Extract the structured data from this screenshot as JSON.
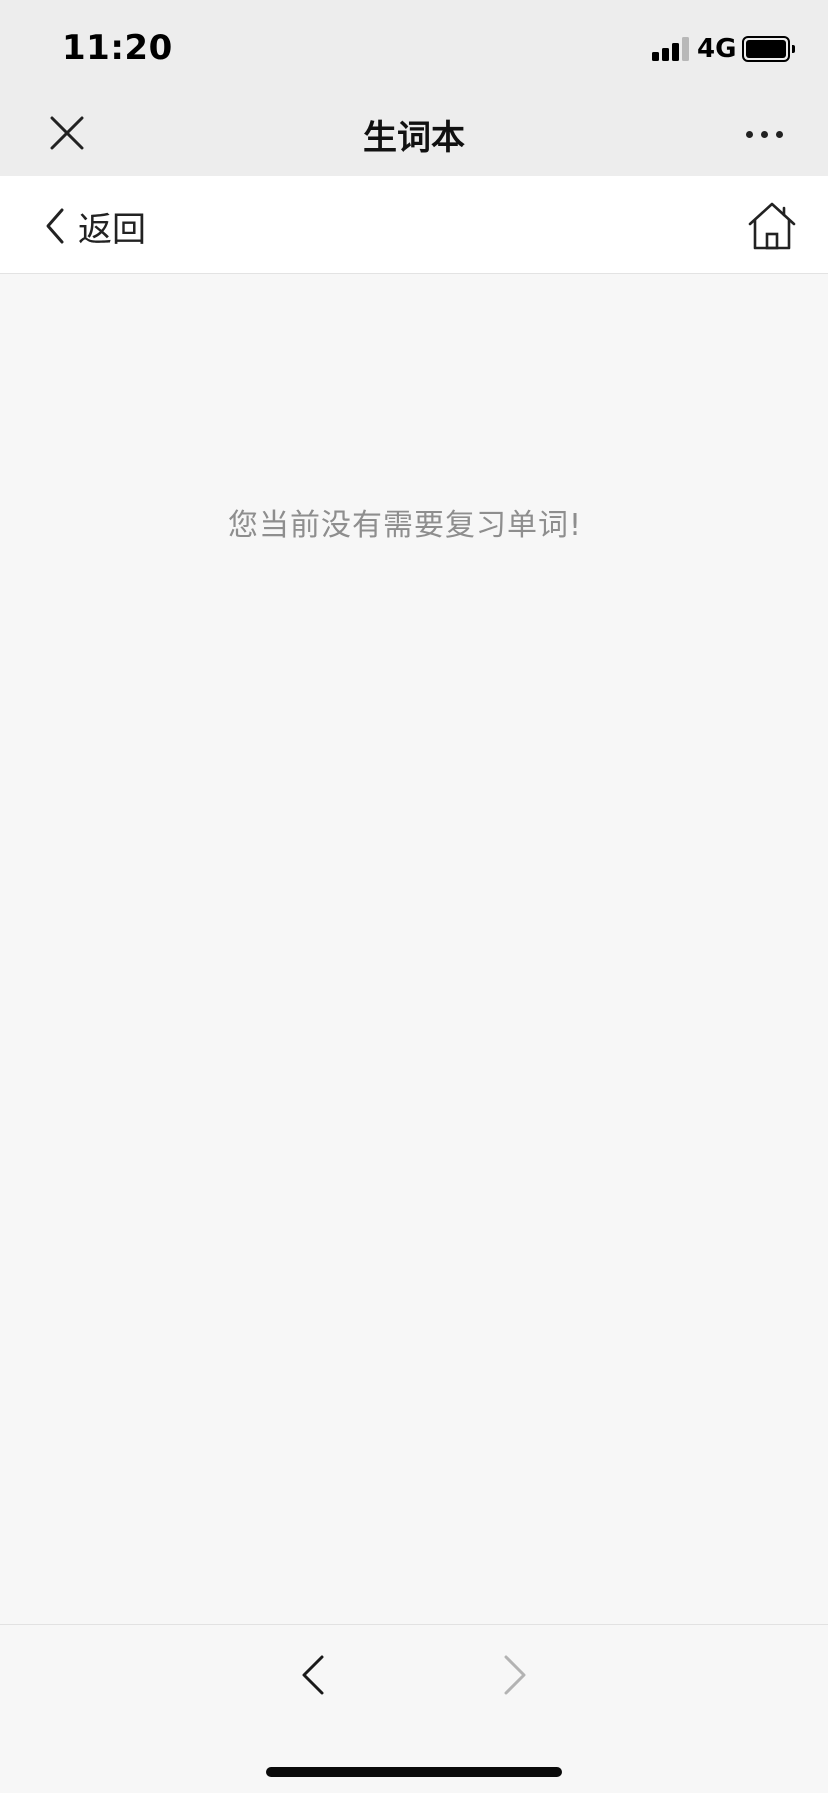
{
  "status_bar": {
    "time": "11:20",
    "network": "4G",
    "icons": [
      "signal-icon",
      "battery-icon"
    ]
  },
  "title_bar": {
    "title": "生词本",
    "icons": [
      "close-icon",
      "more-icon"
    ]
  },
  "nav_bar": {
    "back_label": "返回",
    "icons": [
      "chevron-left-icon",
      "home-icon"
    ]
  },
  "main": {
    "empty_message": "您当前没有需要复习单词!"
  },
  "bottom_toolbar": {
    "icons": [
      "prev-icon",
      "next-icon"
    ],
    "prev_enabled": true,
    "next_enabled": false
  },
  "colors": {
    "header_bg": "#ededed",
    "nav_bg": "#ffffff",
    "page_bg": "#f7f7f7",
    "muted_text": "#8e8e8e",
    "disabled_icon": "#b3b3b3"
  }
}
